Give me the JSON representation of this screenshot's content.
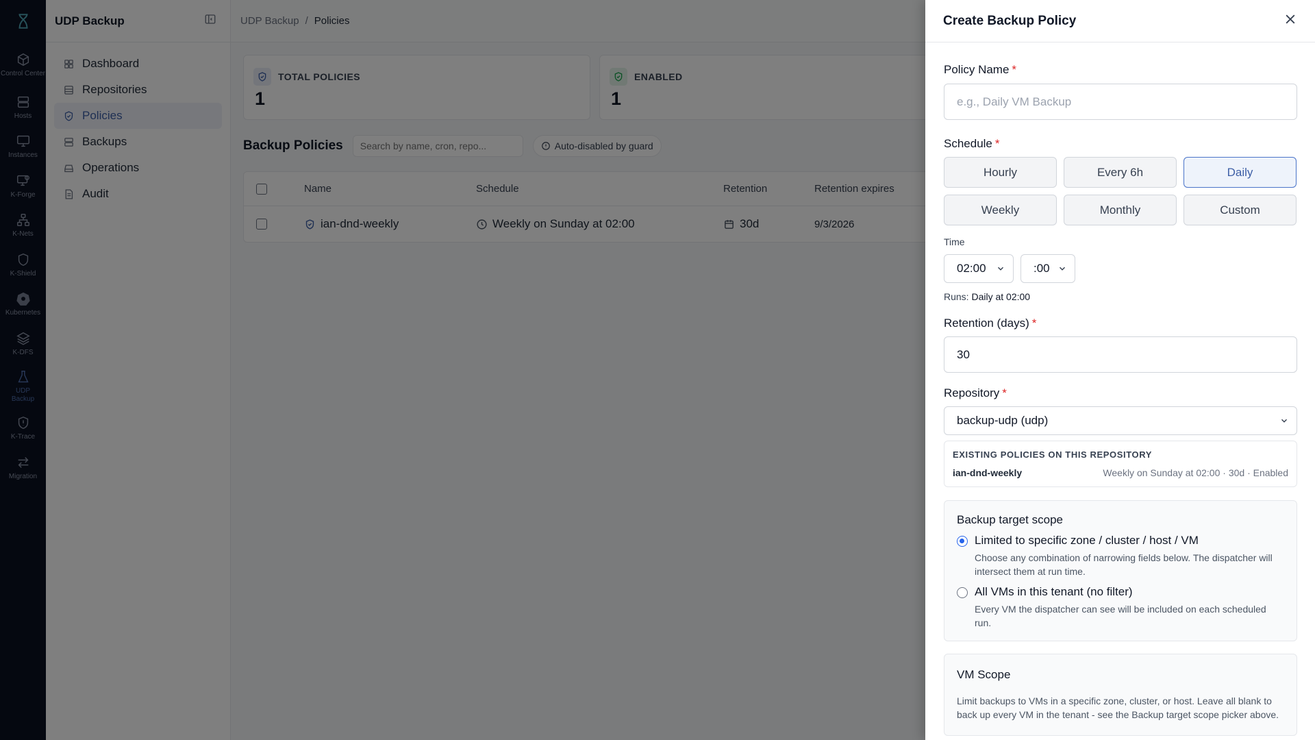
{
  "rail": {
    "items": [
      {
        "label": "Control Center",
        "icon": "cube-icon"
      },
      {
        "label": "Hosts",
        "icon": "server-icon"
      },
      {
        "label": "Instances",
        "icon": "monitor-icon"
      },
      {
        "label": "K-Forge",
        "icon": "forge-icon"
      },
      {
        "label": "K-Nets",
        "icon": "network-icon"
      },
      {
        "label": "K-Shield",
        "icon": "shield-icon"
      },
      {
        "label": "Kubernetes",
        "icon": "helm-icon"
      },
      {
        "label": "K-DFS",
        "icon": "layers-icon"
      },
      {
        "label": "UDP Backup",
        "icon": "flask-icon"
      },
      {
        "label": "K-Trace",
        "icon": "trace-shield-icon"
      },
      {
        "label": "Migration",
        "icon": "arrows-icon"
      }
    ]
  },
  "sidebar": {
    "title": "UDP Backup",
    "items": [
      {
        "label": "Dashboard"
      },
      {
        "label": "Repositories"
      },
      {
        "label": "Policies"
      },
      {
        "label": "Backups"
      },
      {
        "label": "Operations"
      },
      {
        "label": "Audit"
      }
    ]
  },
  "breadcrumb": {
    "root": "UDP Backup",
    "sep": "/",
    "current": "Policies"
  },
  "stats": {
    "total": {
      "label": "TOTAL POLICIES",
      "value": "1"
    },
    "enabled": {
      "label": "ENABLED",
      "value": "1"
    }
  },
  "policies": {
    "title": "Backup Policies",
    "search_placeholder": "Search by name, cron, repo...",
    "chip": "Auto-disabled by guard",
    "columns": {
      "name": "Name",
      "schedule": "Schedule",
      "retention": "Retention",
      "expires": "Retention expires"
    },
    "rows": [
      {
        "name": "ian-dnd-weekly",
        "schedule": "Weekly on Sunday at 02:00",
        "retention": "30d",
        "expires": "9/3/2026"
      }
    ]
  },
  "drawer": {
    "title": "Create Backup Policy",
    "policy_name": {
      "label": "Policy Name",
      "required": "*",
      "placeholder": "e.g., Daily VM Backup"
    },
    "schedule": {
      "label": "Schedule",
      "required": "*",
      "options": [
        "Hourly",
        "Every 6h",
        "Daily",
        "Weekly",
        "Monthly",
        "Custom"
      ],
      "selected": "Daily"
    },
    "time": {
      "label": "Time",
      "hour": "02:00",
      "minute": ":00",
      "runs_label": "Runs:",
      "runs_value": "Daily at 02:00"
    },
    "retention": {
      "label": "Retention (days)",
      "required": "*",
      "value": "30"
    },
    "repository": {
      "label": "Repository",
      "required": "*",
      "value": "backup-udp (udp)"
    },
    "existing": {
      "header": "EXISTING POLICIES ON THIS REPOSITORY",
      "name": "ian-dnd-weekly",
      "detail": "Weekly on Sunday at 02:00 · 30d · Enabled"
    },
    "scope": {
      "title": "Backup target scope",
      "opt1_title": "Limited to specific zone / cluster / host / VM",
      "opt1_desc": "Choose any combination of narrowing fields below. The dispatcher will intersect them at run time.",
      "opt2_title": "All VMs in this tenant (no filter)",
      "opt2_desc": "Every VM the dispatcher can see will be included on each scheduled run.",
      "selected": 1
    },
    "vm_scope": {
      "title": "VM Scope",
      "desc": "Limit backups to VMs in a specific zone, cluster, or host. Leave all blank to back up every VM in the tenant - see the Backup target scope picker above."
    }
  },
  "colors": {
    "accent": "#3d5fa6",
    "rail_bg": "#0b1120",
    "required": "#dc2626",
    "enabled_green": "#16a34a"
  }
}
